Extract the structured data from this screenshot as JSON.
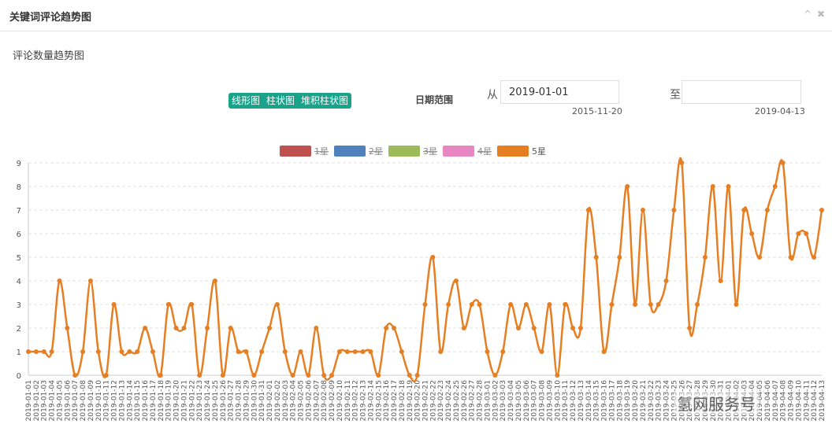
{
  "window": {
    "title": "关键词评论趋势图",
    "collapse_icon": "chevron-up-icon",
    "close_icon": "close-icon"
  },
  "section": {
    "subtitle": "评论数量趋势图"
  },
  "toolbar": {
    "chart_types": [
      "线形图",
      "柱状图",
      "堆积柱状图"
    ],
    "date_range_label": "日期范围",
    "from_label": "从",
    "to_label": "至",
    "from_value": "2019-01-01",
    "to_value": "",
    "from_hint": "2015-11-20",
    "to_hint": "2019-04-13"
  },
  "watermark": "氢网服务号",
  "chart_data": {
    "type": "line",
    "legend": [
      {
        "name": "1星",
        "color": "#c0504d",
        "visible": false
      },
      {
        "name": "2星",
        "color": "#4f81bd",
        "visible": false
      },
      {
        "name": "3星",
        "color": "#9bbb59",
        "visible": false
      },
      {
        "name": "4星",
        "color": "#e887c1",
        "visible": false
      },
      {
        "name": "5星",
        "color": "#e67e22",
        "visible": true
      }
    ],
    "legend_position": "top-center",
    "ylim": [
      0,
      9
    ],
    "yticks": [
      0,
      1,
      2,
      3,
      4,
      5,
      6,
      7,
      8,
      9
    ],
    "x_start": "2019-01-01",
    "x_end": "2019-04-13",
    "grid": "horizontal-dashed",
    "series": [
      {
        "name": "5星",
        "color": "#e67e22",
        "values": [
          1,
          1,
          1,
          1,
          4,
          2,
          0,
          1,
          4,
          1,
          0,
          3,
          1,
          1,
          1,
          2,
          1,
          0,
          3,
          2,
          2,
          3,
          0,
          2,
          4,
          0,
          2,
          1,
          1,
          0,
          1,
          2,
          3,
          1,
          0,
          1,
          0,
          2,
          0,
          0,
          1,
          1,
          1,
          1,
          1,
          0,
          2,
          2,
          1,
          0,
          0,
          3,
          5,
          1,
          3,
          4,
          2,
          3,
          3,
          1,
          0,
          1,
          3,
          2,
          3,
          2,
          1,
          3,
          0,
          3,
          2,
          2,
          7,
          5,
          1,
          3,
          5,
          8,
          3,
          7,
          3,
          3,
          4,
          7,
          9,
          2,
          3,
          5,
          8,
          4,
          8,
          3,
          7,
          6,
          5,
          7,
          8,
          9,
          5,
          6,
          6,
          5,
          7
        ]
      }
    ]
  }
}
